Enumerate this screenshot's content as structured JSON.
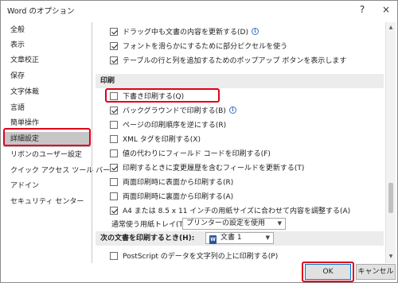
{
  "window": {
    "title": "Word のオプション",
    "help_glyph": "?",
    "close_glyph": "×"
  },
  "sidebar": {
    "items": [
      {
        "label": "全般"
      },
      {
        "label": "表示"
      },
      {
        "label": "文章校正"
      },
      {
        "label": "保存"
      },
      {
        "label": "文字体裁"
      },
      {
        "label": "言語"
      },
      {
        "label": "簡単操作"
      },
      {
        "label": "詳細設定",
        "selected": true
      },
      {
        "label": "リボンのユーザー設定"
      },
      {
        "label": "クイック アクセス ツール バー"
      },
      {
        "label": "アドイン"
      },
      {
        "label": "セキュリティ センター"
      }
    ]
  },
  "content": {
    "top_options": [
      {
        "label": "ドラッグ中も文書の内容を更新する(D)",
        "checked": true,
        "info": true
      },
      {
        "label": "フォントを滑らかにするために部分ピクセルを使う",
        "checked": true
      },
      {
        "label": "テーブルの行と列を追加するためのポップアップ ボタンを表示します",
        "checked": true
      }
    ],
    "print_section": {
      "heading": "印刷",
      "options": [
        {
          "label": "下書き印刷する(Q)",
          "checked": false
        },
        {
          "label": "バックグラウンドで印刷する(B)",
          "checked": true,
          "info": true
        },
        {
          "label": "ページの印刷順序を逆にする(R)",
          "checked": false
        },
        {
          "label": "XML タグを印刷する(X)",
          "checked": false
        },
        {
          "label": "値の代わりにフィールド コードを印刷する(F)",
          "checked": false
        },
        {
          "label": "印刷するときに変更履歴を含むフィールドを更新する(T)",
          "checked": true
        },
        {
          "label": "両面印刷時に表面から印刷する(R)",
          "checked": false
        },
        {
          "label": "両面印刷時に裏面から印刷する(A)",
          "checked": false
        },
        {
          "label": "A4 または 8.5 x 11 インチの用紙サイズに合わせて内容を調整する(A)",
          "checked": true
        }
      ],
      "tray_label": "通常使う用紙トレイ(T):",
      "tray_value": "プリンターの設定を使用"
    },
    "doc_section": {
      "heading": "次の文書を印刷するとき(H):",
      "doc_icon": "word-document-icon",
      "doc_value": "文書 1",
      "options": [
        {
          "label": "PostScript のデータを文字列の上に印刷する(P)",
          "checked": false
        }
      ]
    }
  },
  "footer": {
    "ok_label": "OK",
    "cancel_label": "キャンセル"
  },
  "colors": {
    "highlight_red": "#e0001a",
    "selected_bg": "#c6c6c6",
    "section_bg": "#ececec",
    "primary_border": "#0078d7"
  }
}
